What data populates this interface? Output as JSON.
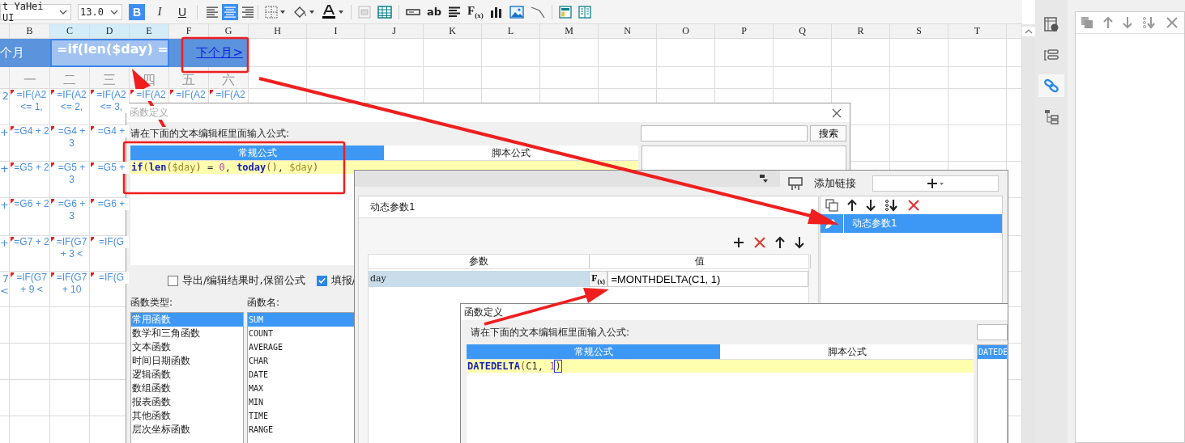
{
  "toolbar": {
    "font": "t YaHei UI",
    "font_size": "13.0",
    "style_buttons": [
      {
        "label": "B",
        "selected": true
      },
      {
        "label": "I",
        "selected": false
      },
      {
        "label": "U",
        "selected": false
      }
    ],
    "align_buttons": [
      {
        "kind": "left",
        "selected": false
      },
      {
        "kind": "center",
        "selected": true
      },
      {
        "kind": "right",
        "selected": false
      }
    ],
    "text_tool": "ab",
    "formula_tool": "F$_{(x)}$"
  },
  "sheet": {
    "columns": [
      {
        "label": "B",
        "highlighted": false
      },
      {
        "label": "C",
        "highlighted": true
      },
      {
        "label": "D",
        "highlighted": true
      },
      {
        "label": "E",
        "highlighted": true
      },
      {
        "label": "F",
        "highlighted": false
      },
      {
        "label": "G",
        "highlighted": false
      },
      {
        "label": "H",
        "highlighted": false
      },
      {
        "label": "I",
        "highlighted": false
      },
      {
        "label": "J",
        "highlighted": false
      },
      {
        "label": "K",
        "highlighted": false
      },
      {
        "label": "L",
        "highlighted": false
      },
      {
        "label": "M",
        "highlighted": false
      },
      {
        "label": "N",
        "highlighted": false
      },
      {
        "label": "O",
        "highlighted": false
      },
      {
        "label": "P",
        "highlighted": false
      },
      {
        "label": "Q",
        "highlighted": false
      },
      {
        "label": "R",
        "highlighted": false
      },
      {
        "label": "S",
        "highlighted": false
      },
      {
        "label": "T",
        "highlighted": false
      }
    ],
    "title_row": {
      "previous": "个月",
      "formula": "=if(len($day) =",
      "next_link": "下个月>"
    },
    "weekdays": [
      "一",
      "二",
      "三",
      "四",
      "五",
      "六"
    ],
    "rows": [
      {
        "edge": "2",
        "cells": [
          "=IF(A2 <= 1,",
          "=IF(A2 <= 2,",
          "=IF(A2 <= 3,",
          "=IF(A2",
          "=IF(A2",
          "=IF(A2"
        ]
      },
      {
        "edge": "+",
        "cells": [
          "=G4 + 2",
          "=G4 + 3",
          "=G4 +"
        ]
      },
      {
        "edge": "+",
        "cells": [
          "=G5 + 2",
          "=G5 + 3",
          "=G5 +"
        ]
      },
      {
        "edge": "+",
        "cells": [
          "=G6 + 2",
          "=G6 + 3",
          "=G6 +"
        ]
      },
      {
        "edge": "+",
        "cells": [
          "=G7 + 2",
          "=IF(G7 + 3 <",
          "=IF(G"
        ]
      },
      {
        "edge": "7 <",
        "cells": [
          "=IF(G7 + 9 <",
          "=IF(G7 + 10",
          "=IF(G"
        ]
      }
    ]
  },
  "formula_dialog": {
    "title": "函数定义",
    "prompt": "请在下面的文本编辑框里面输入公式:",
    "search_button": "搜索",
    "tabs": [
      {
        "label": "常规公式",
        "selected": true
      },
      {
        "label": "脚本公式",
        "selected": false
      }
    ],
    "formula_tokens": [
      {
        "kind": "function",
        "text": "if"
      },
      {
        "kind": "paren",
        "text": "("
      },
      {
        "kind": "function",
        "text": "len"
      },
      {
        "kind": "paren",
        "text": "("
      },
      {
        "kind": "variable",
        "text": "$day"
      },
      {
        "kind": "paren",
        "text": ")"
      },
      {
        "kind": "plain",
        "text": " = "
      },
      {
        "kind": "number",
        "text": "0"
      },
      {
        "kind": "plain",
        "text": ", "
      },
      {
        "kind": "function",
        "text": "today"
      },
      {
        "kind": "paren",
        "text": "()"
      },
      {
        "kind": "plain",
        "text": ", "
      },
      {
        "kind": "variable",
        "text": "$day"
      },
      {
        "kind": "paren",
        "text": ")"
      }
    ],
    "options": [
      {
        "label": "导出/编辑结果时,保留公式",
        "checked": false
      },
      {
        "label": "填报/",
        "checked": true
      }
    ],
    "type_label": "函数类型:",
    "name_label": "函数名:",
    "function_types": [
      {
        "label": "常用函数",
        "selected": true
      },
      {
        "label": "数学和三角函数",
        "selected": false
      },
      {
        "label": "文本函数",
        "selected": false
      },
      {
        "label": "时间日期函数",
        "selected": false
      },
      {
        "label": "逻辑函数",
        "selected": false
      },
      {
        "label": "数组函数",
        "selected": false
      },
      {
        "label": "报表函数",
        "selected": false
      },
      {
        "label": "其他函数",
        "selected": false
      },
      {
        "label": "层次坐标函数",
        "selected": false
      }
    ],
    "function_names": [
      {
        "label": "SUM",
        "selected": true
      },
      {
        "label": "COUNT",
        "selected": false
      },
      {
        "label": "AVERAGE",
        "selected": false
      },
      {
        "label": "CHAR",
        "selected": false
      },
      {
        "label": "DATE",
        "selected": false
      },
      {
        "label": "MAX",
        "selected": false
      },
      {
        "label": "MIN",
        "selected": false
      },
      {
        "label": "TIME",
        "selected": false
      },
      {
        "label": "RANGE",
        "selected": false
      }
    ]
  },
  "link_dialog": {
    "panel_title": "添加链接",
    "tab": "动态参数1",
    "param_header": "参数",
    "value_header": "值",
    "params": [
      {
        "name": "day",
        "fx_label": "F$_{(x)}$",
        "value": "=MONTHDELTA(C1, 1)"
      }
    ],
    "links": [
      {
        "label": "动态参数1",
        "selected": true
      }
    ]
  },
  "date_dialog": {
    "title": "函数定义",
    "prompt": "请在下面的文本编辑框里面输入公式:",
    "tabs": [
      {
        "label": "常规公式",
        "selected": true
      },
      {
        "label": "脚本公式",
        "selected": false
      }
    ],
    "formula_tokens": [
      {
        "kind": "function",
        "text": "DATEDELTA"
      },
      {
        "kind": "paren",
        "text": "("
      },
      {
        "kind": "plain",
        "text": "C1, "
      },
      {
        "kind": "number",
        "text": "1"
      },
      {
        "kind": "matched",
        "text": ")"
      }
    ],
    "function_names": [
      {
        "label": "DATEDE",
        "selected": true
      }
    ]
  },
  "side_rail": [
    {
      "kind": "info",
      "selected": false
    },
    {
      "kind": "widget",
      "selected": false
    },
    {
      "kind": "link",
      "selected": true
    },
    {
      "kind": "tree",
      "selected": false
    }
  ]
}
